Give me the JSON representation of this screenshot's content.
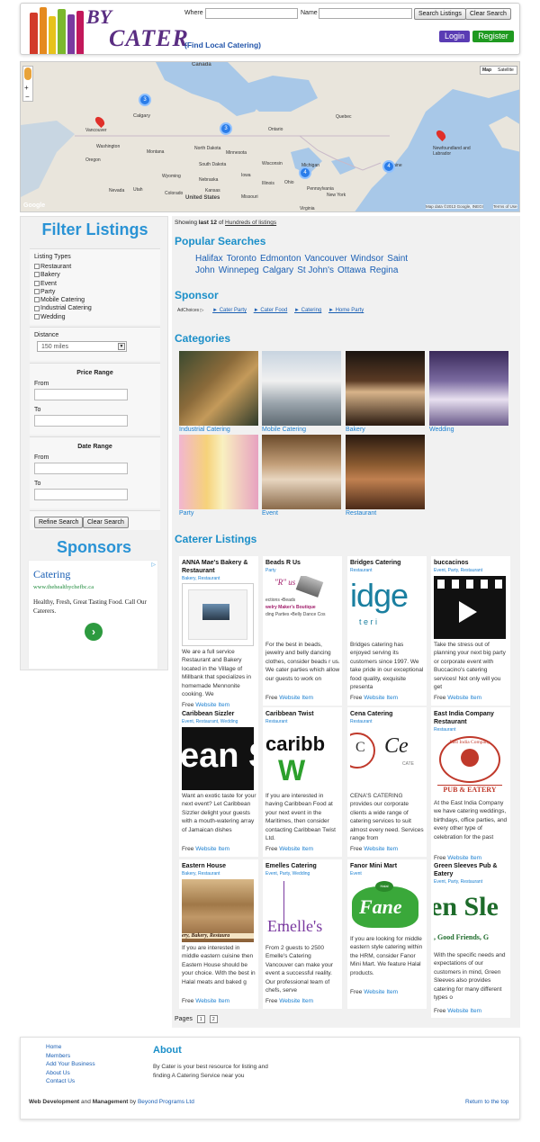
{
  "header": {
    "logo_by": "BY",
    "logo_cater": "CATER",
    "tagline": "(Find Local Catering)",
    "where_label": "Where",
    "name_label": "Name",
    "search_btn": "Search Listings",
    "clear_btn": "Clear Search",
    "login": "Login",
    "register": "Register"
  },
  "map": {
    "labels": {
      "canada": "Canada",
      "calgary": "Calgary",
      "vancouver": "Vancouver",
      "washington": "Washington",
      "oregon": "Oregon",
      "montana": "Montana",
      "north_dakota": "North Dakota",
      "minnesota": "Minnesota",
      "ontario": "Ontario",
      "quebec": "Quebec",
      "south_dakota": "South Dakota",
      "wyoming": "Wyoming",
      "nevada": "Nevada",
      "utah": "Utah",
      "colorado": "Colorado",
      "kansas": "Kansas",
      "nebraska": "Nebraska",
      "iowa": "Iowa",
      "wisconsin": "Wisconsin",
      "michigan": "Michigan",
      "illinois": "Illinois",
      "ohio": "Ohio",
      "pennsylvania": "Pennsylvania",
      "virginia": "Virginia",
      "missouri": "Missouri",
      "united_states": "United States",
      "new_york": "New York",
      "maine": "Maine",
      "newfoundland": "Newfoundland and Labrador"
    },
    "cluster_counts": [
      "3",
      "3",
      "4",
      "4"
    ],
    "type_map": "Map",
    "type_satellite": "Satellite",
    "attribution": "Map data ©2013 Google, INEGI",
    "terms": "Terms of Use",
    "google": "Google"
  },
  "sidebar": {
    "title": "Filter Listings",
    "listing_types_label": "Listing Types",
    "listing_types": [
      "Restaurant",
      "Bakery",
      "Event",
      "Party",
      "Mobile Catering",
      "Industrial Catering",
      "Wedding"
    ],
    "distance_label": "Distance",
    "distance_value": "150 miles",
    "price_range_title": "Price Range",
    "date_range_title": "Date Range",
    "from_label": "From",
    "to_label": "To",
    "refine_btn": "Refine Search",
    "clear_btn": "Clear Search",
    "sponsors_title": "Sponsors",
    "ad": {
      "headline": "Catering",
      "url": "www.thehealthychefbc.ca",
      "body": "Healthy, Fresh, Great Tasting Food. Call Our Caterers.",
      "adchoice": "▷"
    }
  },
  "main": {
    "showing_prefix": "Showing",
    "showing_bold": "last 12",
    "showing_of": "of",
    "showing_link": "Hundreds of listings",
    "popular_title": "Popular Searches",
    "popular": [
      "Halifax",
      "Toronto",
      "Edmonton",
      "Vancouver",
      "Windsor",
      "Saint John",
      "Winnepeg",
      "Calgary",
      "St John's",
      "Ottawa",
      "Regina"
    ],
    "sponsor_title": "Sponsor",
    "adchoices": "AdChoices ▷",
    "sponsor_links": [
      "► Cater Party",
      "► Cater Food",
      "► Catering",
      "► Home Party"
    ],
    "categories_title": "Categories",
    "categories": [
      "Industrial Catering",
      "Mobile Catering",
      "Bakery",
      "Wedding",
      "Party",
      "Event",
      "Restaurant"
    ],
    "caterer_title": "Caterer Listings",
    "pages_label": "Pages",
    "pages": [
      "1",
      "2"
    ]
  },
  "listings": [
    {
      "title": "ANNA Mae's Bakery & Restaurant",
      "tags": "Bakery, Restaurant",
      "desc": "We are a full service Restaurant and Bakery located in the Village of Millbank that specializes in homemade Mennonite cooking. We",
      "free": "Free",
      "link": "Website Item"
    },
    {
      "title": "Beads R Us",
      "tags": "Party",
      "desc": "For the best in beads, jewelry and belly dancing clothes, consider beads r us. We cater parties which allow our guests to work on",
      "free": "Free",
      "link": "Website Item"
    },
    {
      "title": "Bridges Catering",
      "tags": "Restaurant",
      "desc": "Bridges catering has enjoyed serving its customers since 1997. We take pride in our exceptional food quality, exquisite presenta",
      "free": "Free",
      "link": "Website Item"
    },
    {
      "title": "buccacinos",
      "tags": "Event, Party, Restaurant",
      "desc": "Take the stress out of planning your next big party or corporate event with Buccacino's catering services! Not only will you get",
      "free": "Free",
      "link": "Website Item"
    },
    {
      "title": "Caribbean Sizzler",
      "tags": "Event, Restaurant, Wedding",
      "desc": "Want an exotic taste for your next event? Let Caribbean Sizzler delight your guests with a mouth-watering array of Jamaican dishes",
      "free": "Free",
      "link": "Website Item"
    },
    {
      "title": "Caribbean Twist",
      "tags": "Restaurant",
      "desc": "If you are interested in having Caribbean Food at your next event in the Maritimes, then consider contacting Caribbean Twist Ltd.",
      "free": "Free",
      "link": "Website Item"
    },
    {
      "title": "Cena Catering",
      "tags": "Restaurant",
      "desc": "CENA'S CATERING provides our corporate clients a wide range of catering services to suit almost every need. Services range from",
      "free": "Free",
      "link": "Website Item"
    },
    {
      "title": "East India Company Restaurant",
      "tags": "Restaurant",
      "desc": "At the East India Company we have catering weddings, birthdays, office parties, and every other type of celebration for the past",
      "free": "Free",
      "link": "Website Item"
    },
    {
      "title": "Eastern House",
      "tags": "Bakery, Restaurant",
      "desc": "If you are interested in middle eastern cuisine then Eastern House should be your choice. With the best in Halal meats and baked g",
      "free": "Free",
      "link": "Website Item"
    },
    {
      "title": "Emelles Catering",
      "tags": "Event, Party, Wedding",
      "desc": "From 2 guests to 2500 Emelle's Catering Vancouver can make your event a successful reality. Our professional team of chefs, serve",
      "free": "Free",
      "link": "Website Item"
    },
    {
      "title": "Fanor Mini Mart",
      "tags": "Event",
      "desc": "If you are looking for middle eastern style catering within the HRM, consider Fanor Mini Mart. We feature Halal products.",
      "free": "Free",
      "link": "Website Item"
    },
    {
      "title": "Green Sleeves Pub & Eatery",
      "tags": "Event, Party, Restaurant",
      "desc": "With the specific needs and expectations of our customers in mind, Green Sleeves also provides catering for many different types o",
      "free": "Free",
      "link": "Website Item"
    }
  ],
  "listing_images": {
    "beads_1": "\"R\" us",
    "beads_2": "ections •Beads",
    "beads_3": "welry Maker's Boutique",
    "beads_4": "ding Parties •Belly Dance Cos",
    "bridges_1": "idge",
    "bridges_2": "t  e  r  i",
    "sizzler": "ean S",
    "twist_1": "caribb",
    "twist_2": "W",
    "cena_1": "C",
    "cena_2": "Ce",
    "cena_3": "CATE",
    "eic_1": "East India Company",
    "eic_2": "PUB & EATERY",
    "eastern": "ery, Bakery, Restaura",
    "emelles": "Emelle's",
    "fanor": "Fane",
    "fanor_sub": "Halal",
    "sleeves_1": "en Sle",
    "sleeves_2": ", Good Friends, G"
  },
  "footer": {
    "links": [
      "Home",
      "Members",
      "Add Your Business",
      "About Us",
      "Contact Us"
    ],
    "about_title": "About",
    "about_text": "By Cater is your best resource for listing and finding A Catering Service near you",
    "credit_bold1": "Web Development",
    "credit_and": "and",
    "credit_bold2": "Management",
    "credit_by": "by",
    "credit_link": "Beyond Programs Ltd",
    "back_to_top": "Return to the top"
  }
}
